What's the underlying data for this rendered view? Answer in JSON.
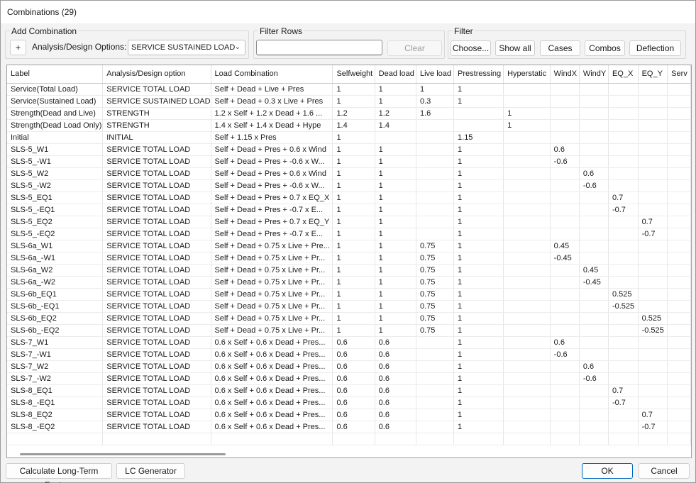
{
  "window": {
    "title": "Combinations (29)"
  },
  "add_combination": {
    "group_label": "Add Combination",
    "add_button": "+",
    "options_label": "Analysis/Design Options:",
    "selected_option": "SERVICE SUSTAINED LOAD"
  },
  "filter_rows": {
    "group_label": "Filter Rows",
    "value": "",
    "clear_label": "Clear"
  },
  "filter": {
    "group_label": "Filter",
    "choose_label": "Choose...",
    "show_all_label": "Show all",
    "cases_label": "Cases",
    "combos_label": "Combos",
    "deflection_label": "Deflection"
  },
  "grid": {
    "columns": [
      "Label",
      "Analysis/Design option",
      "Load Combination",
      "Selfweight",
      "Dead load",
      "Live load",
      "Prestressing",
      "Hyperstatic",
      "WindX",
      "WindY",
      "EQ_X",
      "EQ_Y",
      "Serv"
    ],
    "rows": [
      [
        "Service(Total Load)",
        "SERVICE TOTAL LOAD",
        "Self + Dead + Live + Pres",
        "1",
        "1",
        "1",
        "1",
        "",
        "",
        "",
        "",
        "",
        ""
      ],
      [
        "Service(Sustained Load)",
        "SERVICE SUSTAINED LOAD",
        "Self + Dead + 0.3 x Live + Pres",
        "1",
        "1",
        "0.3",
        "1",
        "",
        "",
        "",
        "",
        "",
        ""
      ],
      [
        "Strength(Dead and Live)",
        "STRENGTH",
        "1.2 x Self + 1.2 x Dead + 1.6 ...",
        "1.2",
        "1.2",
        "1.6",
        "",
        "1",
        "",
        "",
        "",
        "",
        ""
      ],
      [
        "Strength(Dead Load Only)",
        "STRENGTH",
        "1.4 x Self + 1.4 x Dead + Hype",
        "1.4",
        "1.4",
        "",
        "",
        "1",
        "",
        "",
        "",
        "",
        ""
      ],
      [
        "Initial",
        "INITIAL",
        "Self + 1.15 x Pres",
        "1",
        "",
        "",
        "1.15",
        "",
        "",
        "",
        "",
        "",
        ""
      ],
      [
        "SLS-5_W1",
        "SERVICE TOTAL LOAD",
        "Self + Dead + Pres + 0.6 x Wind",
        "1",
        "1",
        "",
        "1",
        "",
        "0.6",
        "",
        "",
        "",
        ""
      ],
      [
        "SLS-5_-W1",
        "SERVICE TOTAL LOAD",
        "Self + Dead + Pres + -0.6 x W...",
        "1",
        "1",
        "",
        "1",
        "",
        "-0.6",
        "",
        "",
        "",
        ""
      ],
      [
        "SLS-5_W2",
        "SERVICE TOTAL LOAD",
        "Self + Dead + Pres + 0.6 x Wind",
        "1",
        "1",
        "",
        "1",
        "",
        "",
        "0.6",
        "",
        "",
        ""
      ],
      [
        "SLS-5_-W2",
        "SERVICE TOTAL LOAD",
        "Self + Dead + Pres + -0.6 x W...",
        "1",
        "1",
        "",
        "1",
        "",
        "",
        "-0.6",
        "",
        "",
        ""
      ],
      [
        "SLS-5_EQ1",
        "SERVICE TOTAL LOAD",
        "Self + Dead + Pres + 0.7 x EQ_X",
        "1",
        "1",
        "",
        "1",
        "",
        "",
        "",
        "0.7",
        "",
        ""
      ],
      [
        "SLS-5_-EQ1",
        "SERVICE TOTAL LOAD",
        "Self + Dead + Pres + -0.7 x E...",
        "1",
        "1",
        "",
        "1",
        "",
        "",
        "",
        "-0.7",
        "",
        ""
      ],
      [
        "SLS-5_EQ2",
        "SERVICE TOTAL LOAD",
        "Self + Dead + Pres + 0.7 x EQ_Y",
        "1",
        "1",
        "",
        "1",
        "",
        "",
        "",
        "",
        "0.7",
        ""
      ],
      [
        "SLS-5_-EQ2",
        "SERVICE TOTAL LOAD",
        "Self + Dead + Pres + -0.7 x E...",
        "1",
        "1",
        "",
        "1",
        "",
        "",
        "",
        "",
        "-0.7",
        ""
      ],
      [
        "SLS-6a_W1",
        "SERVICE TOTAL LOAD",
        "Self + Dead + 0.75 x Live + Pre...",
        "1",
        "1",
        "0.75",
        "1",
        "",
        "0.45",
        "",
        "",
        "",
        ""
      ],
      [
        "SLS-6a_-W1",
        "SERVICE TOTAL LOAD",
        "Self + Dead + 0.75 x Live + Pr...",
        "1",
        "1",
        "0.75",
        "1",
        "",
        "-0.45",
        "",
        "",
        "",
        ""
      ],
      [
        "SLS-6a_W2",
        "SERVICE TOTAL LOAD",
        "Self + Dead + 0.75 x Live + Pr...",
        "1",
        "1",
        "0.75",
        "1",
        "",
        "",
        "0.45",
        "",
        "",
        ""
      ],
      [
        "SLS-6a_-W2",
        "SERVICE TOTAL LOAD",
        "Self + Dead + 0.75 x Live + Pr...",
        "1",
        "1",
        "0.75",
        "1",
        "",
        "",
        "-0.45",
        "",
        "",
        ""
      ],
      [
        "SLS-6b_EQ1",
        "SERVICE TOTAL LOAD",
        "Self + Dead + 0.75 x Live + Pr...",
        "1",
        "1",
        "0.75",
        "1",
        "",
        "",
        "",
        "0.525",
        "",
        ""
      ],
      [
        "SLS-6b_-EQ1",
        "SERVICE TOTAL LOAD",
        "Self + Dead + 0.75 x Live + Pr...",
        "1",
        "1",
        "0.75",
        "1",
        "",
        "",
        "",
        "-0.525",
        "",
        ""
      ],
      [
        "SLS-6b_EQ2",
        "SERVICE TOTAL LOAD",
        "Self + Dead + 0.75 x Live + Pr...",
        "1",
        "1",
        "0.75",
        "1",
        "",
        "",
        "",
        "",
        "0.525",
        ""
      ],
      [
        "SLS-6b_-EQ2",
        "SERVICE TOTAL LOAD",
        "Self + Dead + 0.75 x Live + Pr...",
        "1",
        "1",
        "0.75",
        "1",
        "",
        "",
        "",
        "",
        "-0.525",
        ""
      ],
      [
        "SLS-7_W1",
        "SERVICE TOTAL LOAD",
        "0.6 x Self + 0.6 x Dead + Pres...",
        "0.6",
        "0.6",
        "",
        "1",
        "",
        "0.6",
        "",
        "",
        "",
        ""
      ],
      [
        "SLS-7_-W1",
        "SERVICE TOTAL LOAD",
        "0.6 x Self + 0.6 x Dead + Pres...",
        "0.6",
        "0.6",
        "",
        "1",
        "",
        "-0.6",
        "",
        "",
        "",
        ""
      ],
      [
        "SLS-7_W2",
        "SERVICE TOTAL LOAD",
        "0.6 x Self + 0.6 x Dead + Pres...",
        "0.6",
        "0.6",
        "",
        "1",
        "",
        "",
        "0.6",
        "",
        "",
        ""
      ],
      [
        "SLS-7_-W2",
        "SERVICE TOTAL LOAD",
        "0.6 x Self + 0.6 x Dead + Pres...",
        "0.6",
        "0.6",
        "",
        "1",
        "",
        "",
        "-0.6",
        "",
        "",
        ""
      ],
      [
        "SLS-8_EQ1",
        "SERVICE TOTAL LOAD",
        "0.6 x Self + 0.6 x Dead + Pres...",
        "0.6",
        "0.6",
        "",
        "1",
        "",
        "",
        "",
        "0.7",
        "",
        ""
      ],
      [
        "SLS-8_-EQ1",
        "SERVICE TOTAL LOAD",
        "0.6 x Self + 0.6 x Dead + Pres...",
        "0.6",
        "0.6",
        "",
        "1",
        "",
        "",
        "",
        "-0.7",
        "",
        ""
      ],
      [
        "SLS-8_EQ2",
        "SERVICE TOTAL LOAD",
        "0.6 x Self + 0.6 x Dead + Pres...",
        "0.6",
        "0.6",
        "",
        "1",
        "",
        "",
        "",
        "",
        "0.7",
        ""
      ],
      [
        "SLS-8_-EQ2",
        "SERVICE TOTAL LOAD",
        "0.6 x Self + 0.6 x Dead + Pres...",
        "0.6",
        "0.6",
        "",
        "1",
        "",
        "",
        "",
        "",
        "-0.7",
        ""
      ]
    ]
  },
  "footer": {
    "calc_long_term_label": "Calculate Long-Term Factors",
    "lc_generator_label": "LC Generator",
    "ok_label": "OK",
    "cancel_label": "Cancel"
  },
  "colors": {
    "primary_border": "#0067c0",
    "window_background": "#f3f3f3"
  }
}
